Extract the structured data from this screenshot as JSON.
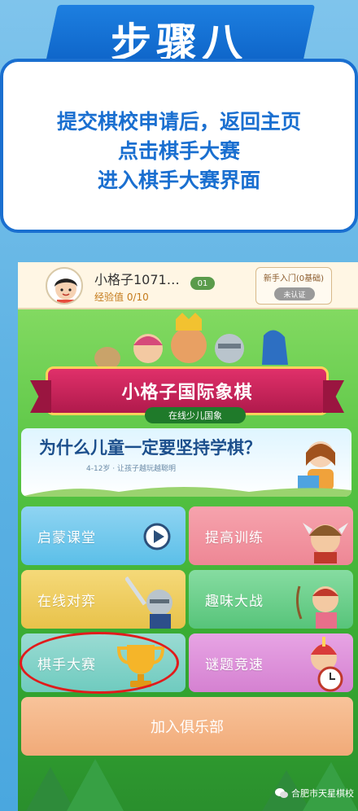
{
  "step": {
    "title": "步骤八"
  },
  "instructions": {
    "lines": [
      "提交棋校申请后，返回主页",
      "点击棋手大赛",
      "进入棋手大赛界面"
    ]
  },
  "app": {
    "header": {
      "user_name": "小格子1071…",
      "level": "01",
      "exp": "经验值 0/10",
      "newbie_label": "新手入门(0基础)",
      "cert_button": "未认证"
    },
    "hero": {
      "title": "小格子国际象棋",
      "subtitle": "在线少儿国象"
    },
    "slogan": {
      "title": "为什么儿童一定要坚持学棋？",
      "subtitle": "4-12岁 · 让孩子越玩越聪明"
    },
    "tiles": [
      {
        "label": "启蒙课堂"
      },
      {
        "label": "提高训练"
      },
      {
        "label": "在线对弈"
      },
      {
        "label": "趣味大战"
      },
      {
        "label": "棋手大赛"
      },
      {
        "label": "谜题竞速"
      }
    ],
    "join_club": "加入俱乐部",
    "watermark": "合肥市天星棋校"
  },
  "colors": {
    "accent_blue": "#1a6fd0",
    "highlight_red": "#e11b1b"
  }
}
